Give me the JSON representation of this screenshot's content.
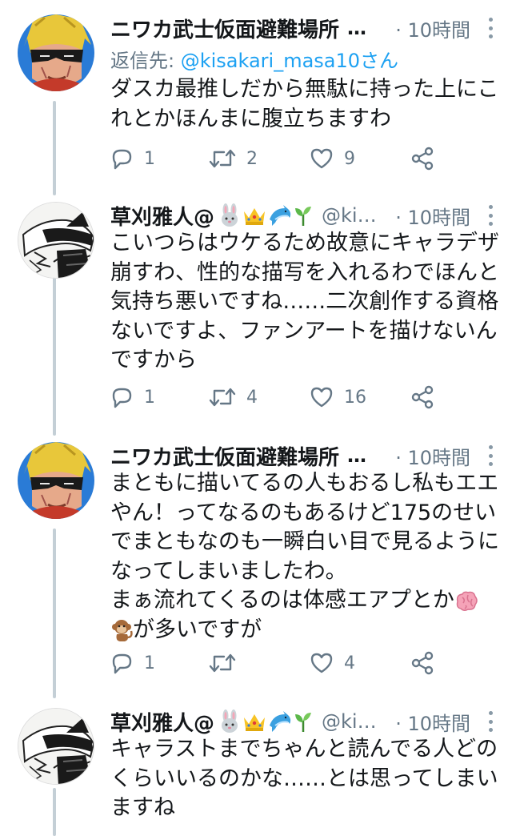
{
  "tweets": [
    {
      "name": "ニワカ武士仮面避難場所",
      "ellipsis": "…",
      "time": "· 10時間",
      "reply_prefix": "返信先: ",
      "reply_handle": "@kisakari_masa10さん",
      "lines": [
        "ダスカ最推しだから無駄に持った上にこ",
        "れとかほんまに腹立ちますわ"
      ],
      "replies": "1",
      "retweets": "2",
      "likes": "9"
    },
    {
      "name": "草刈雅人@",
      "emojis": [
        "rabbit-emoji",
        "crown-emoji",
        "dolphin-emoji",
        "seedling-emoji"
      ],
      "handle": "@ki…",
      "time": "· 10時間",
      "lines": [
        "こいつらはウケるため故意にキャラデザ",
        "崩すわ、性的な描写を入れるわでほんと",
        "気持ち悪いですね……二次創作する資格",
        "ないですよ、ファンアートを描けないん",
        "ですから"
      ],
      "replies": "1",
      "retweets": "4",
      "likes": "16"
    },
    {
      "name": "ニワカ武士仮面避難場所",
      "ellipsis": "…",
      "time": "· 10時間",
      "lines": [
        "まともに描いてるの人もおるし私もエエ",
        "やん！ってなるのもあるけど175のせい",
        "でまともなのも一瞬白い目で見るように",
        "なってしまいましたわ。",
        "まぁ流れてくるのは体感エアプとか",
        "が多いですが"
      ],
      "inline_emojis": [
        "brain-emoji",
        "monkey-emoji"
      ],
      "replies": "1",
      "retweets": "",
      "likes": "4"
    },
    {
      "name": "草刈雅人@",
      "emojis": [
        "rabbit-emoji",
        "crown-emoji",
        "dolphin-emoji",
        "seedling-emoji"
      ],
      "handle": "@ki…",
      "time": "· 10時間",
      "lines": [
        "キャラストまでちゃんと読んでる人どの",
        "くらいいるのかな……とは思ってしまい",
        "ますね"
      ]
    }
  ],
  "colors": {
    "text": "#14171a",
    "secondary": "#657786",
    "link": "#1da1f2",
    "thread": "#c4cfd6"
  }
}
